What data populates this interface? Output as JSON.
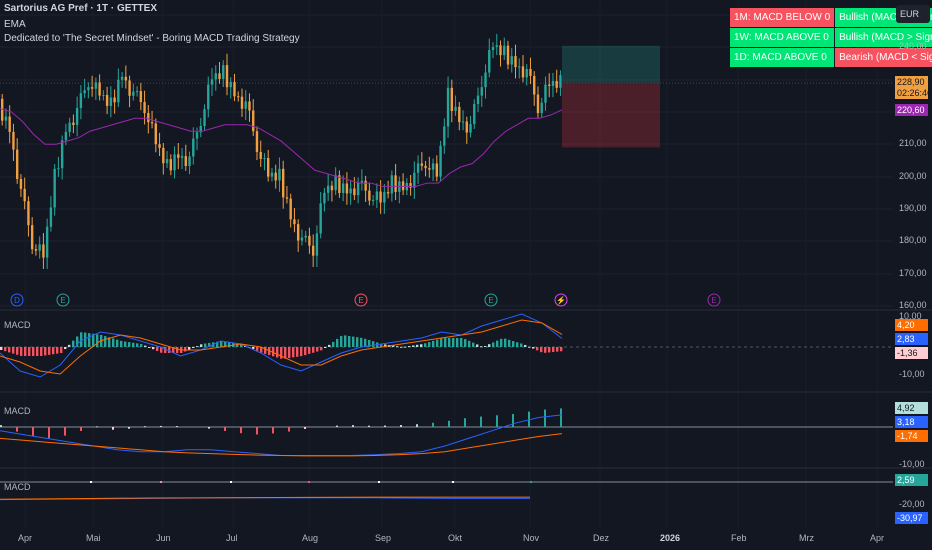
{
  "header": {
    "symbol": "Sartorius AG Pref · 1T · GETTEX",
    "indicator1": "EMA",
    "indicator2": "Dedicated to 'The Secret Mindset' -  Boring MACD Trading Strategy"
  },
  "currency": "EUR",
  "signal_table": [
    {
      "left": "1M: MACD BELOW 0",
      "left_color": "#f7525f",
      "right": "Bullish (MACD > Signal)",
      "right_color": "#00e676"
    },
    {
      "left": "1W: MACD ABOVE 0",
      "left_color": "#00e676",
      "right": "Bullish (MACD > Signal)",
      "right_color": "#00e676"
    },
    {
      "left": "1D: MACD ABOVE 0",
      "left_color": "#00e676",
      "right": "Bearish (MACD < Signal)",
      "right_color": "#f7525f"
    }
  ],
  "price_axis": {
    "ticks": [
      "240,00",
      "210,00",
      "200,00",
      "190,00",
      "180,00",
      "170,00",
      "160,00"
    ],
    "last_price": "228,90",
    "countdown": "02:26:46",
    "ema_value": "220,60"
  },
  "panes": [
    {
      "title": "MACD",
      "ticks": [
        "10,00",
        "-10,00"
      ],
      "labels": [
        {
          "text": "4,20",
          "color": "#ff6d00"
        },
        {
          "text": "2,83",
          "color": "#2962ff"
        },
        {
          "text": "-1,36",
          "color": "#ffcdd2"
        }
      ]
    },
    {
      "title": "MACD",
      "ticks": [
        "-10,00"
      ],
      "labels": [
        {
          "text": "4,92",
          "color": "#b2dfdb"
        },
        {
          "text": "3,18",
          "color": "#2962ff"
        },
        {
          "text": "-1,74",
          "color": "#ff6d00"
        }
      ]
    },
    {
      "title": "MACD",
      "ticks": [
        "-20,00"
      ],
      "labels": [
        {
          "text": "2,59",
          "color": "#26a69a"
        },
        {
          "text": "-30,97",
          "color": "#2962ff"
        }
      ]
    }
  ],
  "time_axis": [
    "Apr",
    "Mai",
    "Jun",
    "Jul",
    "Aug",
    "Sep",
    "Okt",
    "Nov",
    "Dez",
    "2026",
    "Feb",
    "Mrz",
    "Apr"
  ],
  "events": [
    {
      "glyph": "D",
      "color": "#2962ff",
      "type": "dividend"
    },
    {
      "glyph": "E",
      "color": "#26a69a",
      "type": "earnings"
    },
    {
      "glyph": "E",
      "color": "#f7525f",
      "type": "earnings"
    },
    {
      "glyph": "E",
      "color": "#26a69a",
      "type": "earnings"
    },
    {
      "glyph": "⚡",
      "color": "#e040fb",
      "type": "split"
    },
    {
      "glyph": "E",
      "color": "#9c27b0",
      "type": "earnings"
    }
  ],
  "colors": {
    "up": "#26a69a",
    "down": "#f0a040",
    "ema": "#9c27b0",
    "macd": "#2962ff",
    "signal": "#ff6d00"
  },
  "chart_data": {
    "type": "candlestick",
    "ylim": [
      160,
      245
    ],
    "closes": [
      222,
      215,
      195,
      180,
      175,
      200,
      215,
      220,
      230,
      225,
      222,
      232,
      225,
      222,
      210,
      203,
      207,
      205,
      218,
      230,
      232,
      226,
      222,
      210,
      200,
      200,
      188,
      180,
      178,
      195,
      198,
      196,
      197,
      195,
      192,
      198,
      197,
      200,
      205,
      200,
      225,
      218,
      215,
      230,
      240,
      238,
      235,
      232,
      222,
      228,
      228.9
    ],
    "ema": [
      221,
      220,
      217,
      213,
      210,
      210,
      211,
      212,
      214,
      215,
      216,
      217,
      218,
      218,
      217,
      216,
      215,
      214,
      214,
      215,
      216,
      216,
      216,
      215,
      213,
      211,
      208,
      205,
      202,
      201,
      200,
      199,
      198,
      198,
      197,
      197,
      197,
      197,
      198,
      198,
      201,
      203,
      204,
      207,
      211,
      214,
      216,
      218,
      218,
      219,
      220.6
    ],
    "trade": {
      "entry": 229,
      "target": 245,
      "stop": 209
    },
    "macd_daily": {
      "hist": [
        -1,
        -3,
        -3,
        -2,
        5,
        4,
        2,
        1,
        -2,
        -2,
        1,
        2,
        1,
        -2,
        -4,
        -3,
        -1,
        4,
        3,
        1,
        0,
        1,
        3,
        3,
        0,
        3,
        1,
        -2,
        -1.36
      ],
      "macd": [
        -2,
        -8,
        -10,
        -6,
        2,
        5,
        4,
        2,
        0,
        -3,
        -1,
        2,
        1,
        -2,
        -6,
        -8,
        -5,
        -2,
        0,
        1,
        2,
        3,
        5,
        4,
        7,
        9,
        11,
        8,
        2.83
      ],
      "signal": [
        -3,
        -5,
        -8,
        -9,
        -3,
        2,
        4,
        3,
        1,
        -1,
        -1,
        0,
        1,
        0,
        -3,
        -6,
        -6,
        -3,
        -1,
        0,
        1,
        2,
        3,
        4,
        5,
        7,
        9,
        8,
        4.2
      ]
    },
    "macd_weekly": {
      "hist": [
        0.5,
        -2,
        -3,
        -2,
        0.3,
        -1,
        0.2,
        0.3,
        0.2,
        -0.5,
        -1.5,
        -2,
        -1.5,
        -0.5,
        0.3,
        0.5,
        0.3,
        0.5,
        0.8,
        1.5,
        2.5,
        3,
        3.5,
        4.5,
        4.92
      ],
      "macd": [
        -1,
        -2,
        -3,
        -4,
        -5,
        -6,
        -6.5,
        -6.5,
        -6,
        -6,
        -6.5,
        -7,
        -7.5,
        -7.5,
        -7.5,
        -7.5,
        -7.3,
        -7,
        -6.5,
        -5,
        -3,
        -1,
        1,
        2.5,
        3.18
      ],
      "signal": [
        -3,
        -3.5,
        -4,
        -4.5,
        -5,
        -5.5,
        -6,
        -6.5,
        -6.8,
        -7,
        -7.2,
        -7.4,
        -7.5,
        -7.6,
        -7.6,
        -7.6,
        -7.5,
        -7.3,
        -7,
        -6.5,
        -5.5,
        -4.5,
        -3.5,
        -2.5,
        -1.74
      ]
    },
    "macd_monthly": {
      "macd": [
        -29,
        -30,
        -31,
        -32,
        -32,
        -32,
        -31,
        -30.97
      ],
      "signal": [
        -28,
        -29,
        -30,
        -30.5,
        -31,
        -31.5,
        -31.5,
        -31.5
      ]
    }
  }
}
